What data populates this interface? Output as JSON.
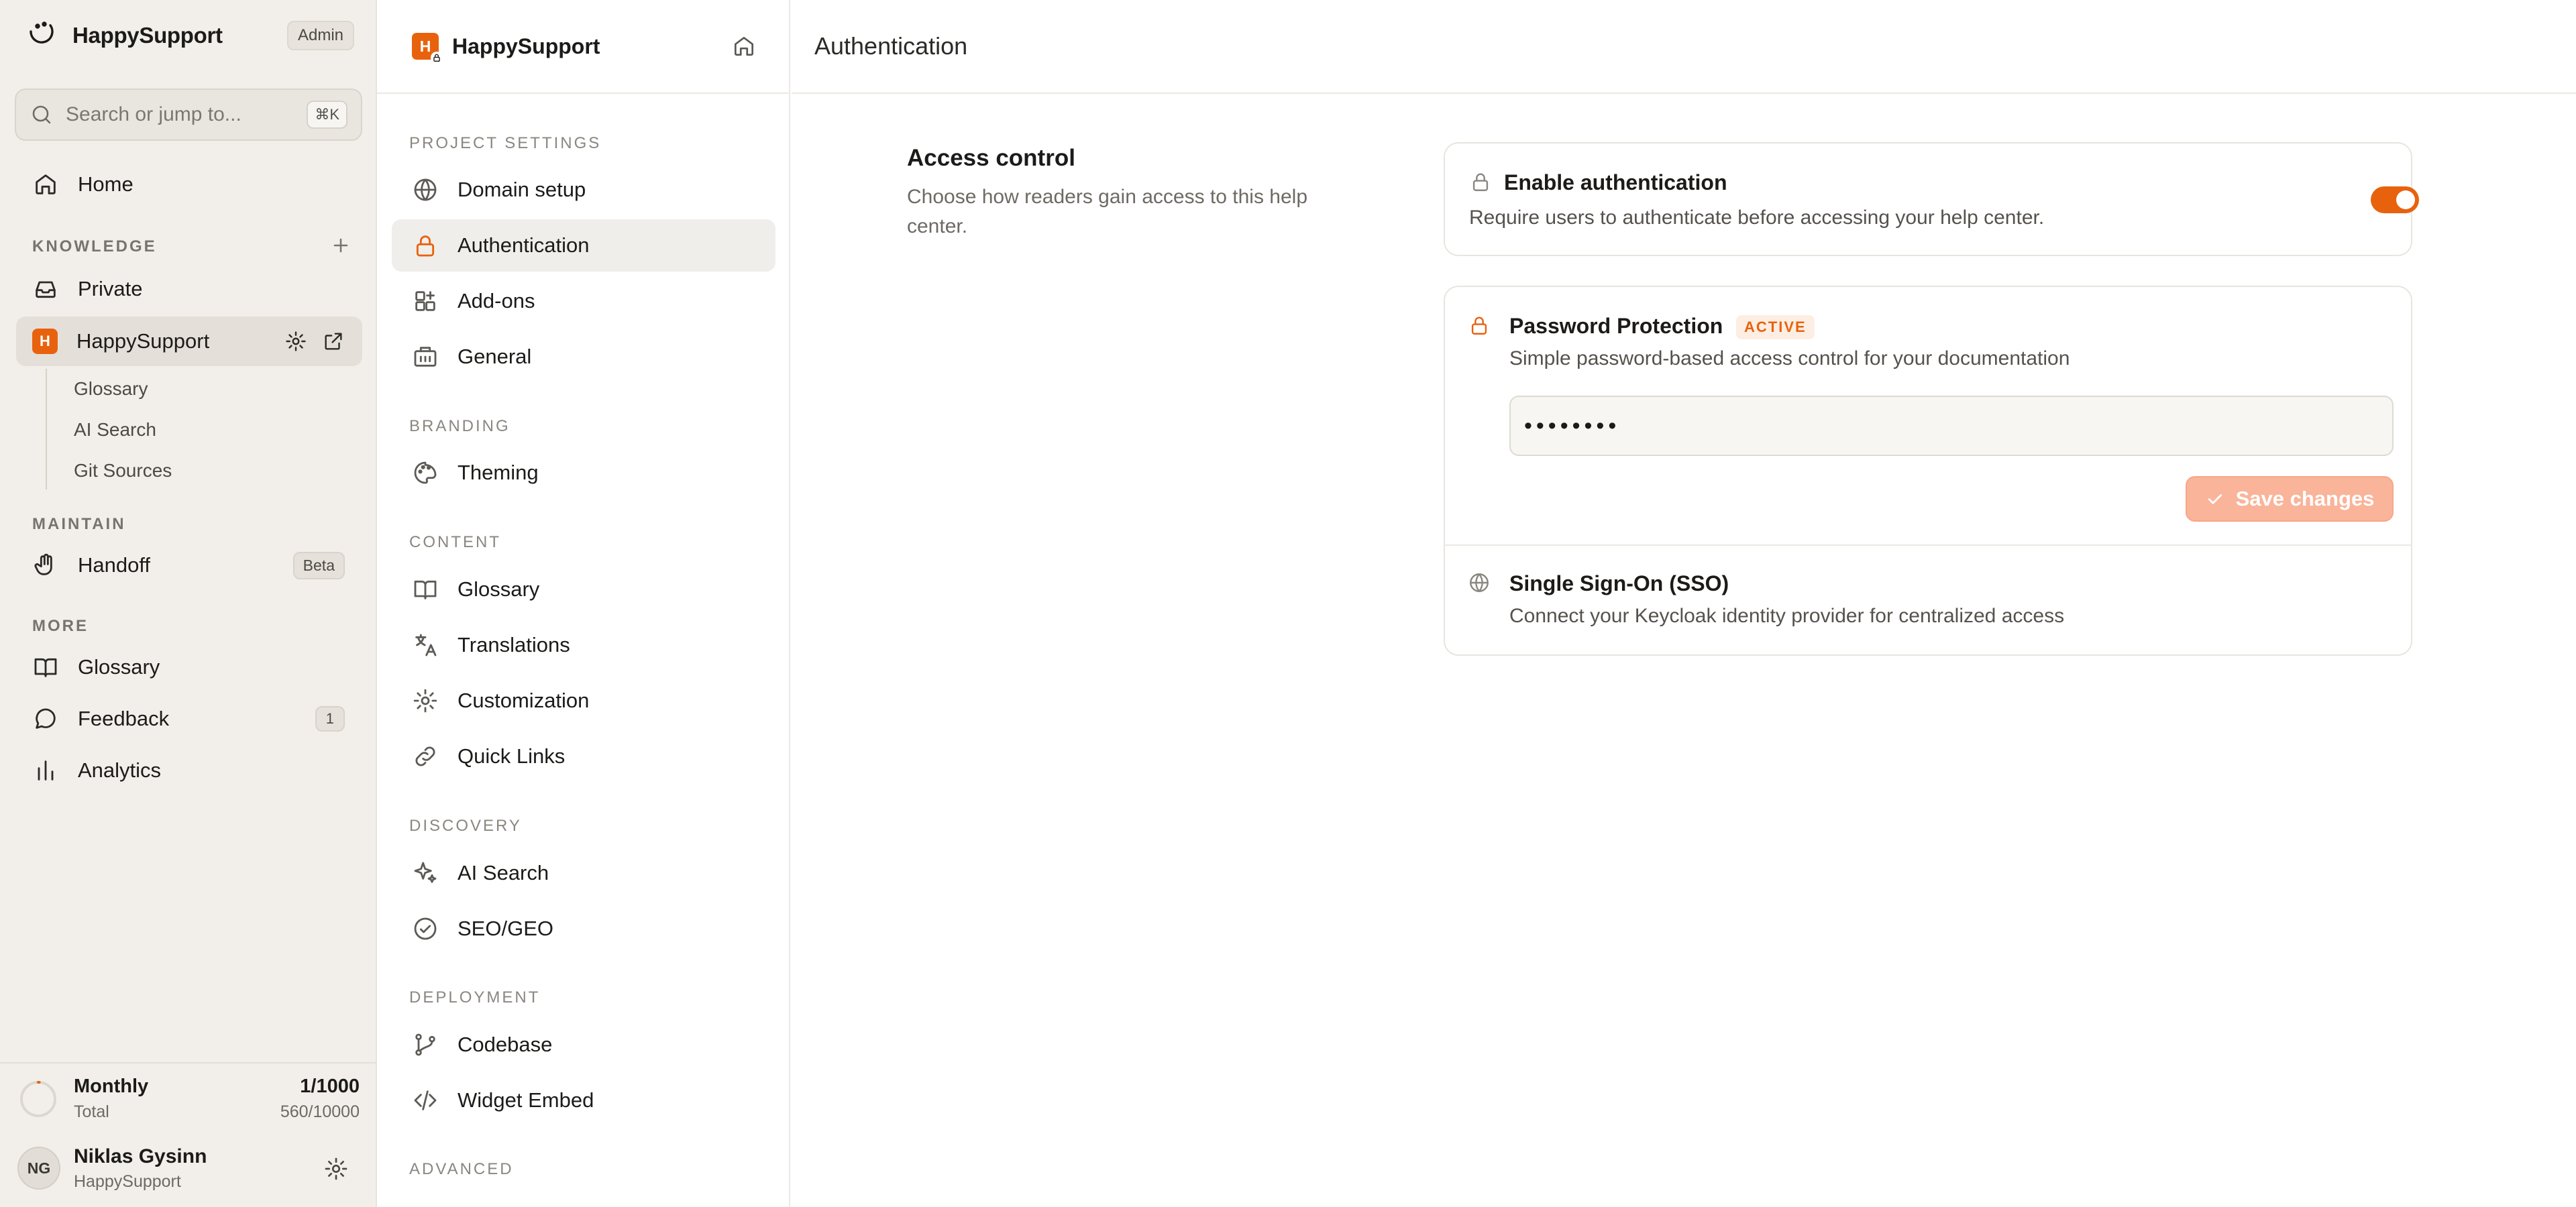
{
  "sidebar": {
    "brand": "HappySupport",
    "role_badge": "Admin",
    "search_placeholder": "Search or jump to...",
    "search_shortcut": "⌘K",
    "home": "Home",
    "knowledge_section": "KNOWLEDGE",
    "private": "Private",
    "project": {
      "badge": "H",
      "label": "HappySupport"
    },
    "sub_items": [
      "Glossary",
      "AI Search",
      "Git Sources"
    ],
    "maintain_section": "MAINTAIN",
    "handoff": {
      "label": "Handoff",
      "badge": "Beta"
    },
    "more_section": "MORE",
    "glossary": "Glossary",
    "feedback": {
      "label": "Feedback",
      "count": "1"
    },
    "analytics": "Analytics",
    "usage": {
      "title": "Monthly",
      "subtitle": "Total",
      "value": "1/1000",
      "total": "560/10000",
      "fraction": 0.001
    },
    "user": {
      "initials": "NG",
      "name": "Niklas Gysinn",
      "org": "HappySupport"
    }
  },
  "settings": {
    "project_badge": "H",
    "project_name": "HappySupport",
    "sections": {
      "project": "PROJECT SETTINGS",
      "branding": "BRANDING",
      "content": "CONTENT",
      "discovery": "DISCOVERY",
      "deployment": "DEPLOYMENT",
      "advanced": "ADVANCED"
    },
    "items": {
      "domain": "Domain setup",
      "authentication": "Authentication",
      "addons": "Add-ons",
      "general": "General",
      "theming": "Theming",
      "glossary": "Glossary",
      "translations": "Translations",
      "customization": "Customization",
      "quicklinks": "Quick Links",
      "aisearch": "AI Search",
      "seo": "SEO/GEO",
      "codebase": "Codebase",
      "widget": "Widget Embed"
    }
  },
  "main": {
    "title": "Authentication",
    "access": {
      "title": "Access control",
      "description": "Choose how readers gain access to this help center."
    },
    "enable_auth": {
      "title": "Enable authentication",
      "description": "Require users to authenticate before accessing your help center.",
      "enabled": true
    },
    "password": {
      "title": "Password Protection",
      "status": "ACTIVE",
      "description": "Simple password-based access control for your documentation",
      "value": "••••••••",
      "save_label": "Save changes"
    },
    "sso": {
      "title": "Single Sign-On (SSO)",
      "description": "Connect your Keycloak identity provider for centralized access"
    }
  },
  "colors": {
    "accent": "#e8620e",
    "sidebar_bg": "#f2efea",
    "save_disabled": "#f9b49a"
  }
}
